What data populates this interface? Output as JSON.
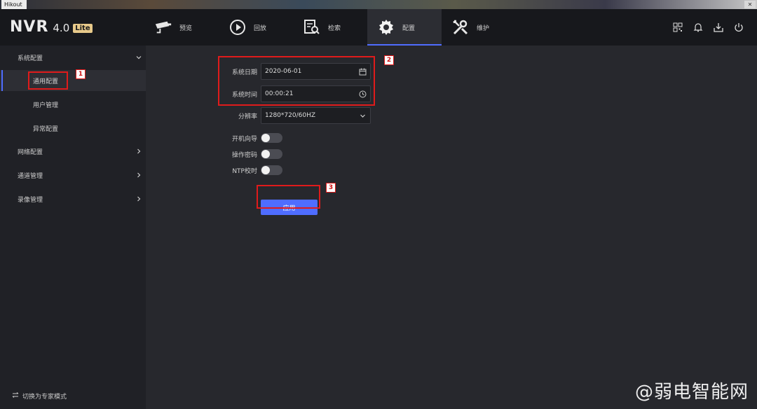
{
  "os": {
    "window_title": "Hikout",
    "close_btn": "✕"
  },
  "header": {
    "brand": "NVR",
    "version": "4.0",
    "edition": "Lite",
    "nav": [
      {
        "label": "预览",
        "icon": "camera-icon"
      },
      {
        "label": "回放",
        "icon": "playback-icon"
      },
      {
        "label": "检索",
        "icon": "search-doc-icon"
      },
      {
        "label": "配置",
        "icon": "gear-icon",
        "active": true
      },
      {
        "label": "维护",
        "icon": "wrench-icon"
      }
    ],
    "right_icons": [
      "qr-code-icon",
      "bell-icon",
      "download-icon",
      "power-icon"
    ]
  },
  "sidebar": {
    "groups": [
      {
        "label": "系统配置",
        "expanded": true,
        "items": [
          {
            "label": "通用配置",
            "selected": true
          },
          {
            "label": "用户管理"
          },
          {
            "label": "异常配置"
          }
        ]
      },
      {
        "label": "网络配置",
        "expanded": false
      },
      {
        "label": "通道管理",
        "expanded": false
      },
      {
        "label": "录像管理",
        "expanded": false
      }
    ],
    "footer": "切换为专家模式"
  },
  "form": {
    "date_label": "系统日期",
    "date_value": "2020-06-01",
    "time_label": "系统时间",
    "time_value": "00:00:21",
    "resolution_label": "分辨率",
    "resolution_value": "1280*720/60HZ",
    "wizard_label": "开机向导",
    "wizard_on": false,
    "password_label": "操作密码",
    "password_on": false,
    "ntp_label": "NTP校时",
    "ntp_on": false,
    "apply_label": "应用"
  },
  "annotations": [
    "1",
    "2",
    "3"
  ],
  "watermark": "@弱电智能网",
  "colors": {
    "accent": "#4f6dff",
    "annotation": "#e01b1b",
    "header_bg": "#17181c",
    "panel_bg": "#27282d"
  }
}
